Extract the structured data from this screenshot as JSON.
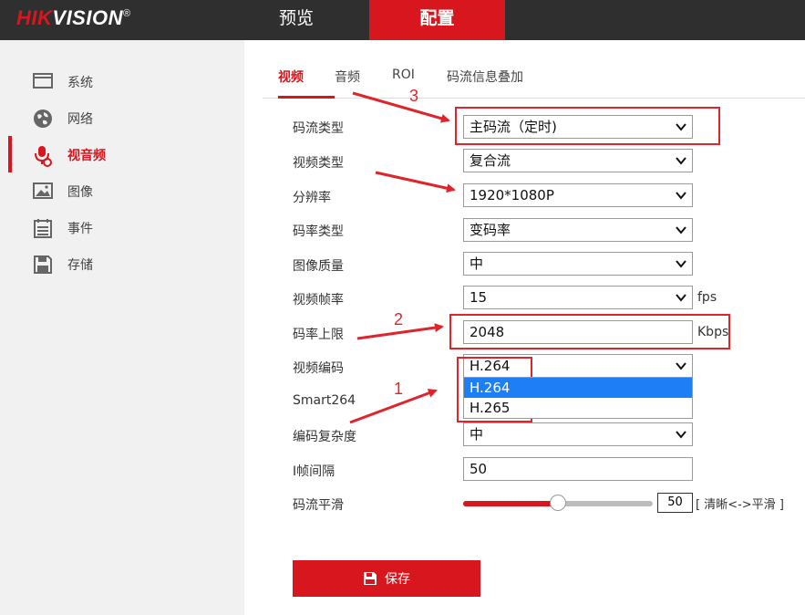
{
  "brand": {
    "logo_hik": "HIK",
    "logo_vision": "VISION",
    "logo_mark": "®"
  },
  "top_nav": {
    "preview": "预览",
    "config": "配置"
  },
  "sidebar": {
    "items": [
      {
        "label": "系统",
        "icon": "monitor-icon"
      },
      {
        "label": "网络",
        "icon": "globe-icon"
      },
      {
        "label": "视音频",
        "icon": "microphone-icon",
        "active": true
      },
      {
        "label": "图像",
        "icon": "image-icon"
      },
      {
        "label": "事件",
        "icon": "calendar-icon"
      },
      {
        "label": "存储",
        "icon": "save-disk-icon"
      }
    ]
  },
  "subtabs": {
    "video": "视频",
    "audio": "音频",
    "roi": "ROI",
    "osd": "码流信息叠加"
  },
  "form": {
    "stream_type": {
      "label": "码流类型",
      "value": "主码流（定时)"
    },
    "video_type": {
      "label": "视频类型",
      "value": "复合流"
    },
    "resolution": {
      "label": "分辨率",
      "value": "1920*1080P"
    },
    "bitrate_type": {
      "label": "码率类型",
      "value": "变码率"
    },
    "image_quality": {
      "label": "图像质量",
      "value": "中"
    },
    "frame_rate": {
      "label": "视频帧率",
      "value": "15",
      "unit": "fps"
    },
    "max_bitrate": {
      "label": "码率上限",
      "value": "2048",
      "unit": "Kbps"
    },
    "video_encoding": {
      "label": "视频编码",
      "value": "H.264",
      "options": [
        "H.264",
        "H.265"
      ],
      "highlighted": "H.264"
    },
    "smart264": {
      "label": "Smart264"
    },
    "encoding_complexity": {
      "label": "编码复杂度",
      "value": "中"
    },
    "i_frame_interval": {
      "label": "I帧间隔",
      "value": "50"
    },
    "stream_smoothing": {
      "label": "码流平滑",
      "value": "50",
      "level": 0.5,
      "hint": "[ 清晰<->平滑 ]"
    }
  },
  "save_button": {
    "label": "保存"
  },
  "annotations": {
    "n1": "1",
    "n2": "2",
    "n3": "3",
    "color": "#e0242b"
  },
  "colors": {
    "accent": "#d7161e",
    "topbar": "#2f2f2f",
    "sidebar": "#f1f1f1",
    "dropdown_highlight": "#1e7ef6"
  }
}
